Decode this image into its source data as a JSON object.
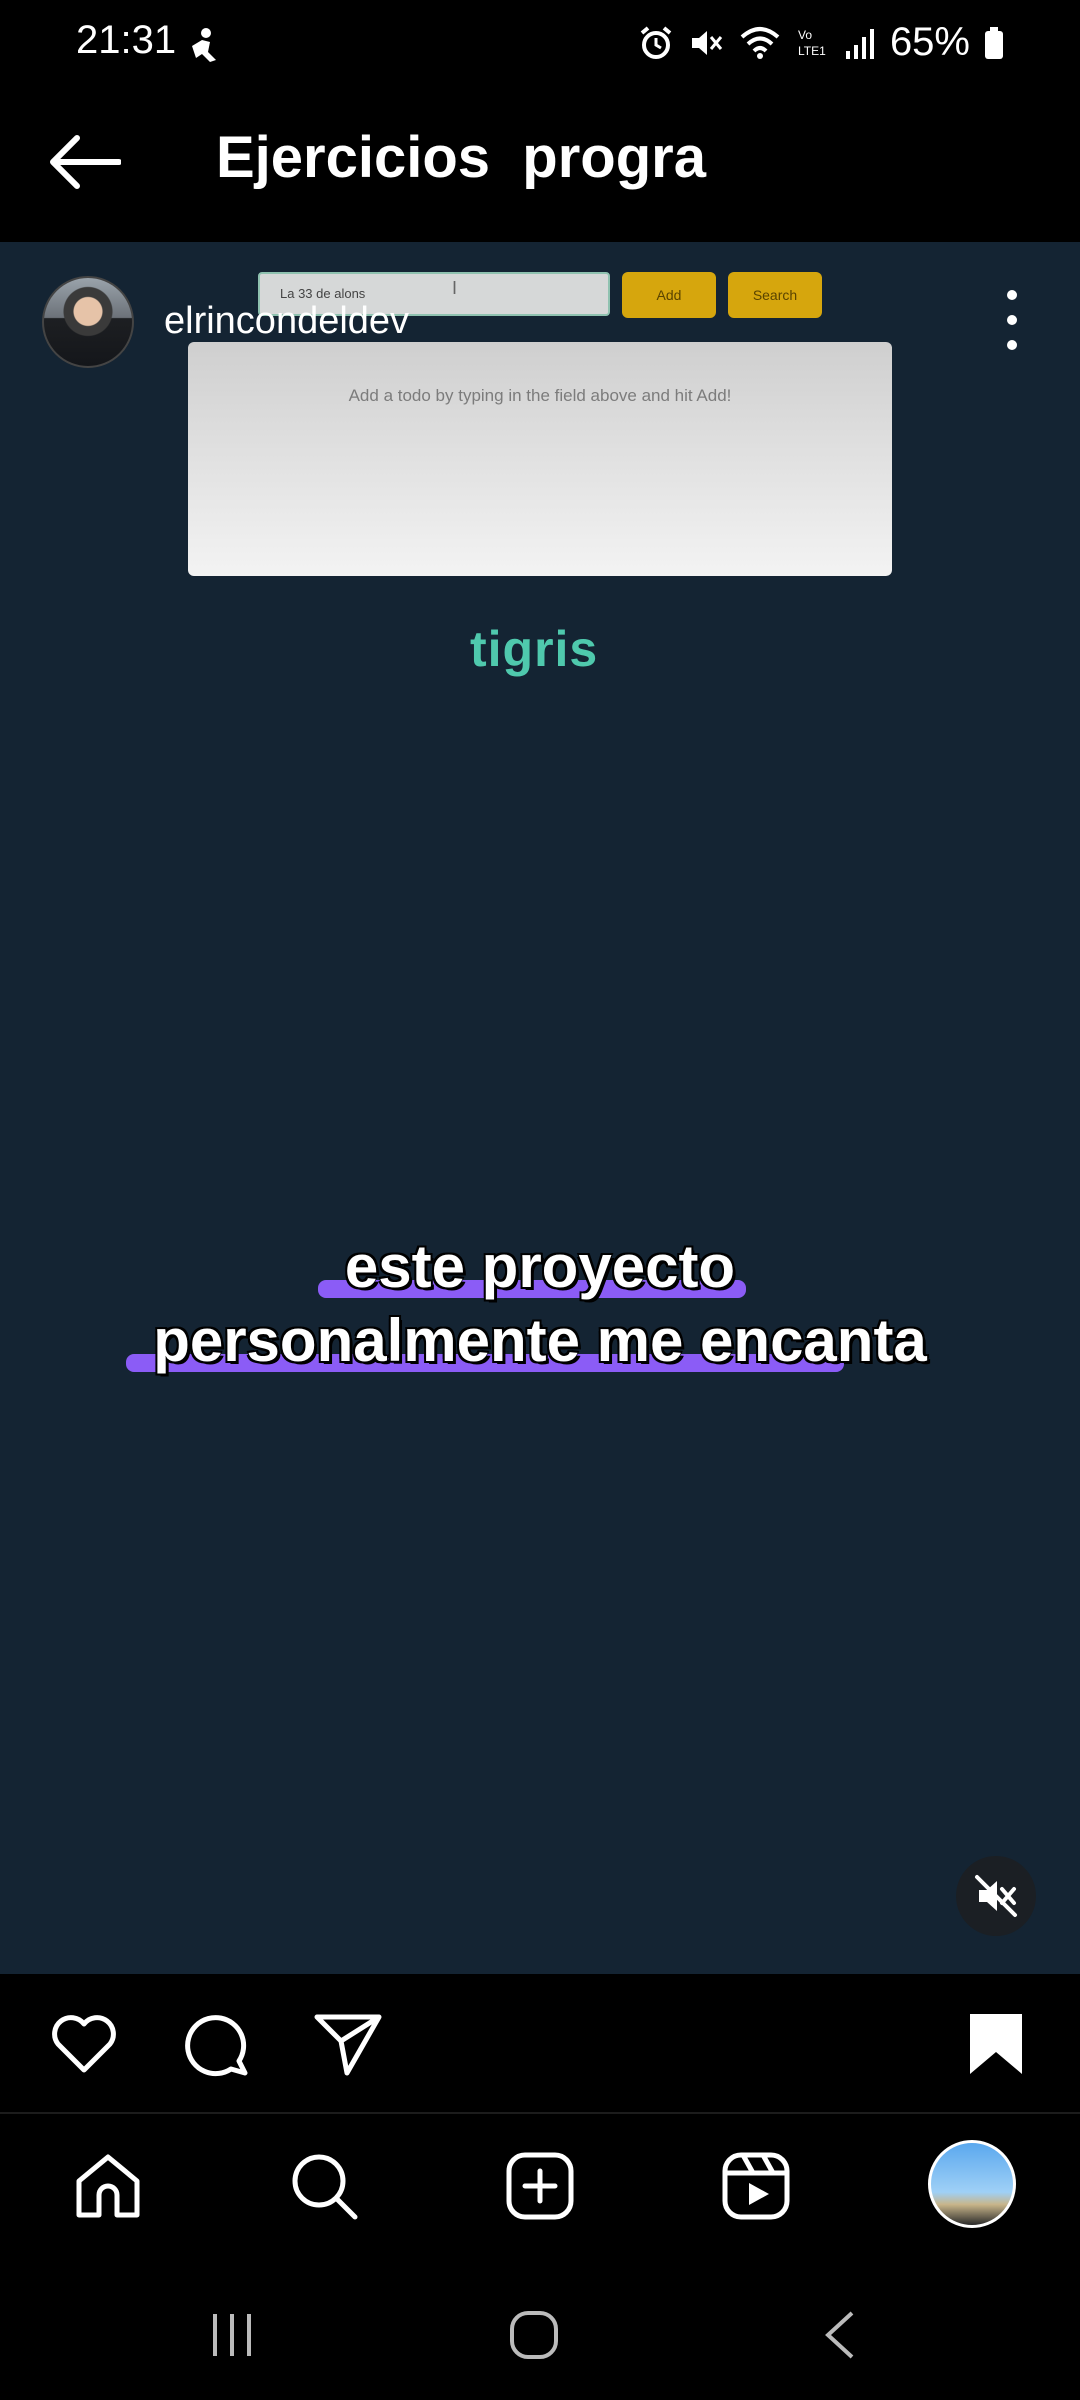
{
  "status_bar": {
    "time": "21:31",
    "battery": "65%"
  },
  "header": {
    "title": "Ejercicios  progra"
  },
  "post": {
    "username": "elrincondeldev"
  },
  "video": {
    "todo_input_value": "La 33 de alons",
    "add_label": "Add",
    "search_label": "Search",
    "empty_message": "Add a todo by typing in the field above and hit Add!",
    "logo_text": "tigris",
    "caption_line_1": "este proyecto",
    "caption_line_2": "personalmente me encanta"
  },
  "colors": {
    "video_bg": "#142433",
    "accent_yellow": "#d6a60d",
    "caption_highlight": "#8b5cf6",
    "logo_teal": "#4fc9ad"
  }
}
